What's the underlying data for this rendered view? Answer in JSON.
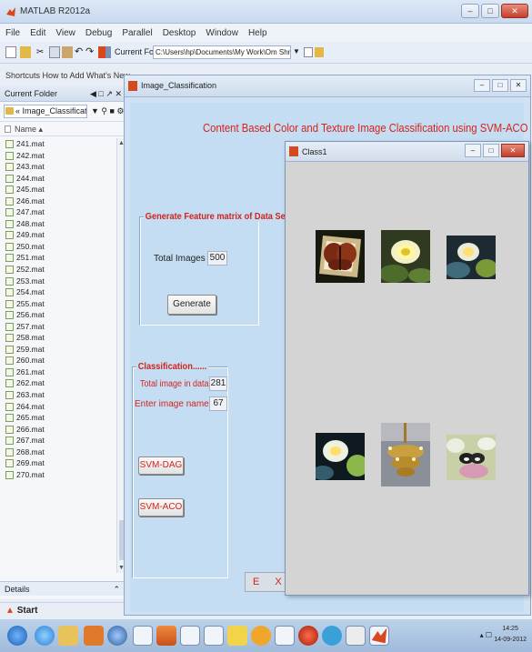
{
  "window": {
    "title": "MATLAB R2012a"
  },
  "menu": [
    "File",
    "Edit",
    "View",
    "Debug",
    "Parallel",
    "Desktop",
    "Window",
    "Help"
  ],
  "toolbar": {
    "current_folder_label": "Current Folder:",
    "current_folder_path": "C:\\Users\\hp\\Documents\\My Work\\Om Shri Sai\\Image_Classification"
  },
  "shortcuts": {
    "text": "Shortcuts  How to Add  What's New"
  },
  "folder_panel": {
    "title": "Current Folder",
    "path": "« Image_Classification ▸",
    "column": "Name ▴",
    "files": [
      "241.mat",
      "242.mat",
      "243.mat",
      "244.mat",
      "245.mat",
      "246.mat",
      "247.mat",
      "248.mat",
      "249.mat",
      "250.mat",
      "251.mat",
      "252.mat",
      "253.mat",
      "254.mat",
      "255.mat",
      "256.mat",
      "257.mat",
      "258.mat",
      "259.mat",
      "260.mat",
      "261.mat",
      "262.mat",
      "263.mat",
      "264.mat",
      "265.mat",
      "266.mat",
      "267.mat",
      "268.mat",
      "269.mat",
      "270.mat"
    ],
    "details": "Details"
  },
  "start": "Start",
  "figure": {
    "title": "Image_Classification",
    "heading": "Content Based Color and Texture Image Classification using SVM-ACO",
    "feature_group": {
      "title": "Generate Feature matrix of Data Set",
      "total_label": "Total Images in",
      "total_value": "500",
      "generate_label": "Generate"
    },
    "class_group": {
      "title": "Classification......",
      "total_label": "Total image in data set",
      "total_value": "281",
      "enter_label": "Enter image name",
      "enter_value": "67",
      "svm_dag_label": "SVM-DAG",
      "svm_aco_label": "SVM-ACO"
    },
    "exit_label": "E X I T"
  },
  "class_window": {
    "title": "Class1"
  },
  "clock": {
    "time": "14:25",
    "date": "14-09-2012"
  }
}
